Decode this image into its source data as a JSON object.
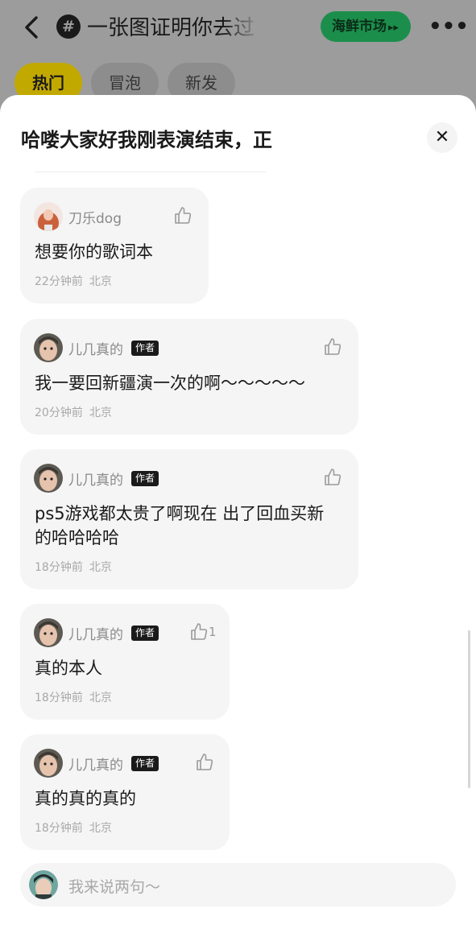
{
  "topic_bar": {
    "title": "一张图证明你去过",
    "hash_icon": "#",
    "market_label": "海鲜市场",
    "more_label": "•••",
    "tabs": [
      {
        "label": "热门",
        "active": true
      },
      {
        "label": "冒泡",
        "active": false
      },
      {
        "label": "新发",
        "active": false
      }
    ]
  },
  "sheet": {
    "title": "哈喽大家好我刚表演结束，正",
    "close_label": "✕"
  },
  "comments": [
    {
      "user": "刀乐dog",
      "is_author": false,
      "author_label": "",
      "text": "想要你的歌词本",
      "time": "22分钟前",
      "location": "北京",
      "likes": ""
    },
    {
      "user": "儿几真的",
      "is_author": true,
      "author_label": "作者",
      "text": "我一要回新疆演一次的啊～～～～～",
      "time": "20分钟前",
      "location": "北京",
      "likes": ""
    },
    {
      "user": "儿几真的",
      "is_author": true,
      "author_label": "作者",
      "text": "ps5游戏都太贵了啊现在 出了回血买新的哈哈哈哈",
      "time": "18分钟前",
      "location": "北京",
      "likes": ""
    },
    {
      "user": "儿几真的",
      "is_author": true,
      "author_label": "作者",
      "text": "真的本人",
      "time": "18分钟前",
      "location": "北京",
      "likes": "1"
    },
    {
      "user": "儿几真的",
      "is_author": true,
      "author_label": "作者",
      "text": "真的真的真的",
      "time": "18分钟前",
      "location": "北京",
      "likes": ""
    }
  ],
  "input": {
    "placeholder": "我来说两句～"
  },
  "colors": {
    "accent_green": "#1c8e4c",
    "hot_tab_yellow": "#f2d300",
    "card_background": "#f5f5f5",
    "author_badge": "#1a1a1a"
  },
  "icons": {
    "back": "chevron-left-icon",
    "hash": "hashtag-icon",
    "market_arrow": "double-chevron-right-icon",
    "more": "more-dots-icon",
    "close": "close-icon",
    "like": "thumbs-up-icon"
  }
}
